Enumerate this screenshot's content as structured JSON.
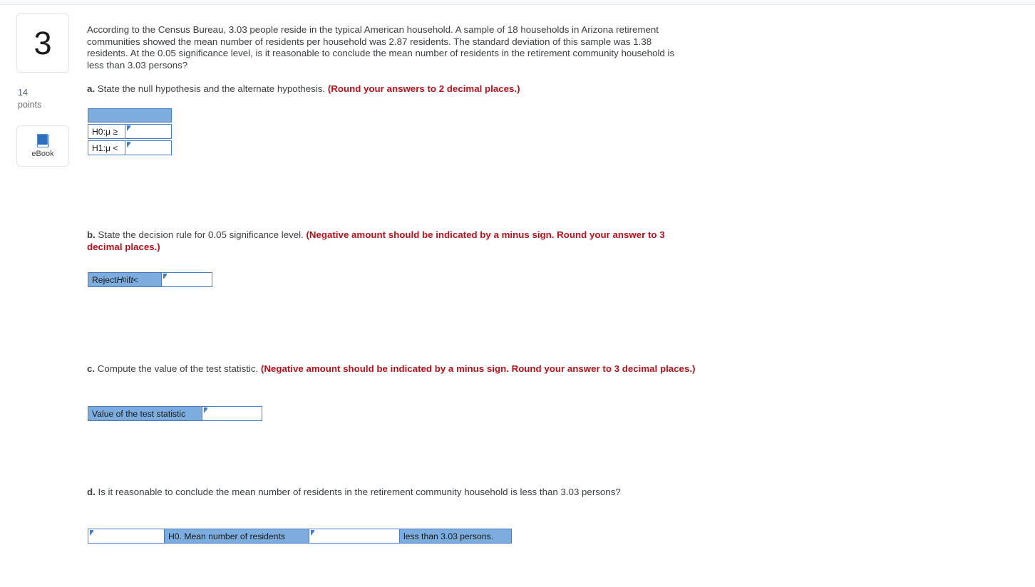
{
  "question": {
    "number": "3",
    "points_value": "14",
    "points_label": "points",
    "ebook_label": "eBook",
    "body": "According to the Census Bureau, 3.03 people reside in the typical American household. A sample of 18 households in Arizona retirement communities showed the mean number of residents per household was 2.87 residents. The standard deviation of this sample was 1.38 residents. At the 0.05 significance level, is it reasonable to conclude the mean number of residents in the retirement community household is less than 3.03 persons?"
  },
  "parts": {
    "a": {
      "marker": "a.",
      "prompt": " State the null hypothesis and the alternate hypothesis. ",
      "instruction": "(Round your answers to 2 decimal places.)",
      "table": {
        "header": "",
        "rows": [
          {
            "label_prefix": "H0: ",
            "label_mu": "μ ≥",
            "answer": ""
          },
          {
            "label_prefix": "H1: ",
            "label_mu": "μ <",
            "answer": ""
          }
        ]
      }
    },
    "b": {
      "marker": "b.",
      "prompt": " State the decision rule for 0.05 significance level. ",
      "instruction": "(Negative amount should be indicated by a minus sign. Round your answer to 3 decimal places.)",
      "rule_label_pre": "Reject ",
      "rule_label_h": "H",
      "rule_label_sub": "0",
      "rule_label_if": " if ",
      "rule_label_t": "t",
      "rule_label_lt": " <",
      "answer": ""
    },
    "c": {
      "marker": "c.",
      "prompt": " Compute the value of the test statistic. ",
      "instruction": "(Negative amount should be indicated by a minus sign. Round your answer to 3 decimal places.)",
      "label": "Value of the test statistic",
      "answer": ""
    },
    "d": {
      "marker": "d.",
      "prompt": " Is it reasonable to conclude the mean number of residents in the retirement community household is less than 3.03 persons?",
      "answer1": "",
      "middle_label": "H0. Mean number of residents",
      "answer2": "",
      "end_label": "less than 3.03 persons."
    }
  },
  "colors": {
    "accent_blue": "#7cadde",
    "border_blue": "#4a7ebb",
    "instruction_red": "#b5121b",
    "text": "#3c4043"
  }
}
